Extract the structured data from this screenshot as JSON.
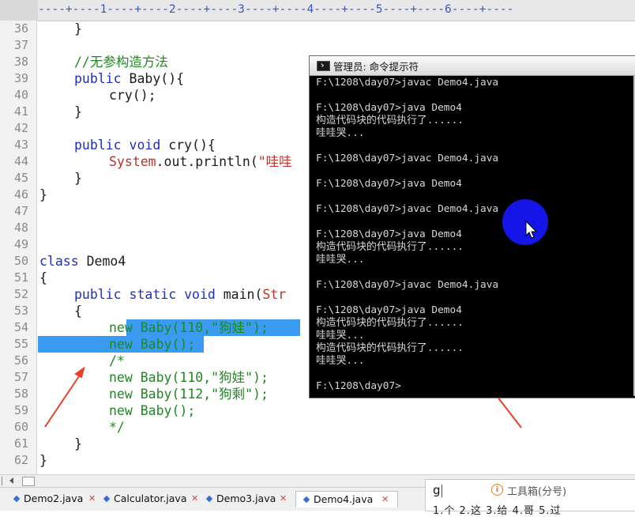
{
  "ruler": {
    "text": "----+----1----+----2----+----3----+----4----+----5----+----6----+----"
  },
  "editor": {
    "lines": [
      {
        "num": "36",
        "indent": 1,
        "parts": [
          {
            "t": "}",
            "c": ""
          }
        ]
      },
      {
        "num": "37",
        "indent": 0,
        "parts": []
      },
      {
        "num": "38",
        "indent": 1,
        "parts": [
          {
            "t": "//无参构造方法",
            "c": "cm"
          }
        ]
      },
      {
        "num": "39",
        "indent": 1,
        "parts": [
          {
            "t": "public",
            "c": "kw"
          },
          {
            "t": " Baby(){",
            "c": ""
          }
        ]
      },
      {
        "num": "40",
        "indent": 2,
        "parts": [
          {
            "t": "cry();",
            "c": ""
          }
        ]
      },
      {
        "num": "41",
        "indent": 1,
        "parts": [
          {
            "t": "}",
            "c": ""
          }
        ]
      },
      {
        "num": "42",
        "indent": 0,
        "parts": []
      },
      {
        "num": "43",
        "indent": 1,
        "parts": [
          {
            "t": "public void",
            "c": "kw"
          },
          {
            "t": " cry(){",
            "c": ""
          }
        ]
      },
      {
        "num": "44",
        "indent": 2,
        "parts": [
          {
            "t": "System",
            "c": "st"
          },
          {
            "t": ".out.println(",
            "c": ""
          },
          {
            "t": "\"哇哇",
            "c": "st"
          }
        ]
      },
      {
        "num": "45",
        "indent": 1,
        "parts": [
          {
            "t": "}",
            "c": ""
          }
        ]
      },
      {
        "num": "46",
        "indent": 0,
        "parts": [
          {
            "t": "}",
            "c": ""
          }
        ]
      },
      {
        "num": "47",
        "indent": 0,
        "parts": []
      },
      {
        "num": "48",
        "indent": 0,
        "parts": []
      },
      {
        "num": "49",
        "indent": 0,
        "parts": []
      },
      {
        "num": "50",
        "indent": 0,
        "parts": [
          {
            "t": "class",
            "c": "kw"
          },
          {
            "t": " Demo4",
            "c": ""
          }
        ]
      },
      {
        "num": "51",
        "indent": 0,
        "parts": [
          {
            "t": "{",
            "c": ""
          }
        ]
      },
      {
        "num": "52",
        "indent": 1,
        "parts": [
          {
            "t": "public static void",
            "c": "kw"
          },
          {
            "t": " main(",
            "c": ""
          },
          {
            "t": "Str",
            "c": "st"
          }
        ]
      },
      {
        "num": "53",
        "indent": 1,
        "parts": [
          {
            "t": "{",
            "c": ""
          }
        ]
      },
      {
        "num": "54",
        "indent": 2,
        "parts": [
          {
            "t": "new",
            "c": "cm"
          },
          {
            "t": " Baby(110,\"狗娃\");",
            "c": "cm"
          }
        ]
      },
      {
        "num": "55",
        "indent": 2,
        "parts": [
          {
            "t": "new",
            "c": "cm"
          },
          {
            "t": " Baby();",
            "c": "cm"
          }
        ]
      },
      {
        "num": "56",
        "indent": 2,
        "parts": [
          {
            "t": "/*",
            "c": "cm"
          }
        ]
      },
      {
        "num": "57",
        "indent": 2,
        "parts": [
          {
            "t": "new Baby(110,\"狗娃\");",
            "c": "cm"
          }
        ]
      },
      {
        "num": "58",
        "indent": 2,
        "parts": [
          {
            "t": "new Baby(112,\"狗剩\");",
            "c": "cm"
          }
        ]
      },
      {
        "num": "59",
        "indent": 2,
        "parts": [
          {
            "t": "new Baby();",
            "c": "cm"
          }
        ]
      },
      {
        "num": "60",
        "indent": 2,
        "parts": [
          {
            "t": "*/",
            "c": "cm"
          }
        ]
      },
      {
        "num": "61",
        "indent": 1,
        "parts": [
          {
            "t": "}",
            "c": ""
          }
        ]
      },
      {
        "num": "62",
        "indent": 0,
        "parts": [
          {
            "t": "}",
            "c": ""
          }
        ]
      }
    ]
  },
  "cmd": {
    "title": "管理员: 命令提示符",
    "lines": [
      "F:\\1208\\day07>javac Demo4.java",
      "",
      "F:\\1208\\day07>java Demo4",
      "构造代码块的代码执行了......",
      "哇哇哭...",
      "",
      "F:\\1208\\day07>javac Demo4.java",
      "",
      "F:\\1208\\day07>java Demo4",
      "",
      "F:\\1208\\day07>javac Demo4.java",
      "",
      "F:\\1208\\day07>java Demo4",
      "构造代码块的代码执行了......",
      "哇哇哭...",
      "",
      "F:\\1208\\day07>javac Demo4.java",
      "",
      "F:\\1208\\day07>java Demo4",
      "构造代码块的代码执行了......",
      "哇哇哭...",
      "构造代码块的代码执行了......",
      "哇哇哭...",
      "",
      "F:\\1208\\day07>"
    ]
  },
  "tabs": [
    {
      "label": "Demo2.java",
      "active": false
    },
    {
      "label": "Calculator.java",
      "active": false
    },
    {
      "label": "Demo3.java",
      "active": false
    },
    {
      "label": "Demo4.java",
      "active": true
    }
  ],
  "ime": {
    "typed": "g",
    "toolbox": "工具箱(分号)",
    "candidates": "1.个 2.这 3.给 4.哥 5.过"
  },
  "colors": {
    "selection": "#3a9bf0",
    "keyword": "#1d2fc0",
    "comment": "#1d8a1d",
    "string": "#c0302a",
    "arrow": "#e8402a",
    "cursor": "#1515e8"
  }
}
